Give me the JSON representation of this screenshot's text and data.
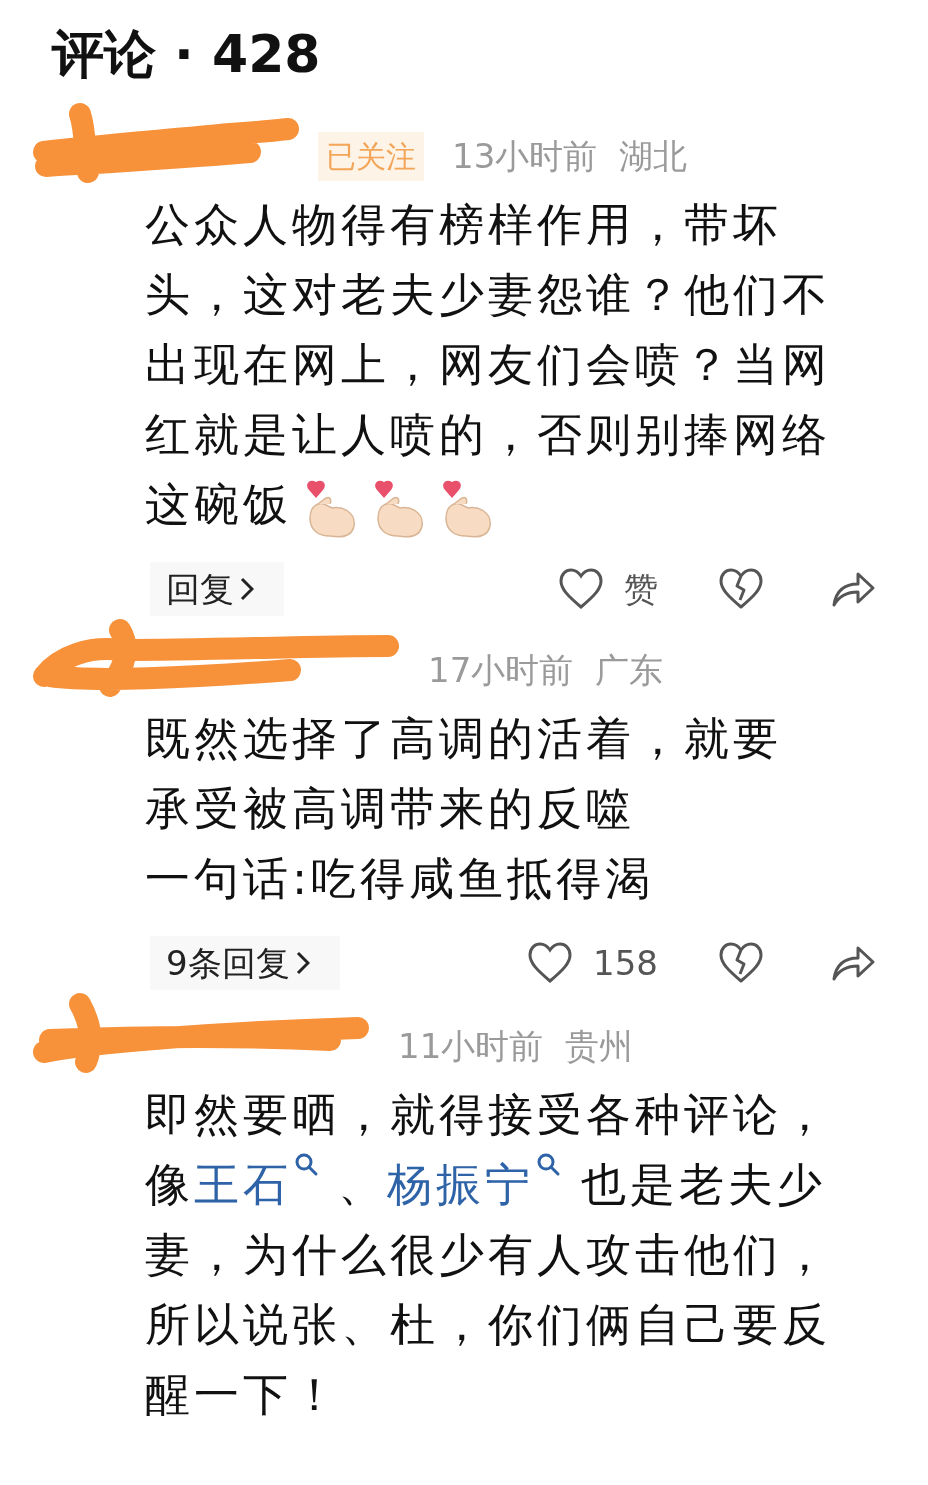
{
  "title": "评论 · 428",
  "comments": [
    {
      "followed": true,
      "follow_label": "已关注",
      "time": "13小时前",
      "region": "湖北",
      "body": [
        {
          "kind": "text",
          "text": "公众人物得有榜样作用，带坏头，这对老夫少妻怨谁？他们不出现在网上，网友们会喷？当网红就是让人喷的，否则别捧网络这碗饭"
        },
        {
          "kind": "emoji"
        },
        {
          "kind": "emoji"
        },
        {
          "kind": "emoji"
        }
      ],
      "reply_label": "回复",
      "like_label": "赞"
    },
    {
      "followed": false,
      "time": "17小时前",
      "region": "广东",
      "body": [
        {
          "kind": "text",
          "text": "既然选择了高调的活着，就要"
        },
        {
          "kind": "break"
        },
        {
          "kind": "text",
          "text": "承受被高调带来的反噬"
        },
        {
          "kind": "break"
        },
        {
          "kind": "text",
          "text": "一句话:吃得咸鱼抵得渴"
        }
      ],
      "reply_label": "9条回复",
      "like_label": "158"
    },
    {
      "followed": false,
      "time": "11小时前",
      "region": "贵州",
      "body": [
        {
          "kind": "text",
          "text": "即然要晒，就得接受各种评论，像"
        },
        {
          "kind": "link",
          "text": "王石"
        },
        {
          "kind": "text",
          "text": " 、"
        },
        {
          "kind": "link",
          "text": "杨振宁"
        },
        {
          "kind": "text",
          "text": " 也是老夫少妻，为什么很少有人攻击他们，所以说张、杜，你们俩自己要反醒一下！"
        }
      ]
    }
  ]
}
